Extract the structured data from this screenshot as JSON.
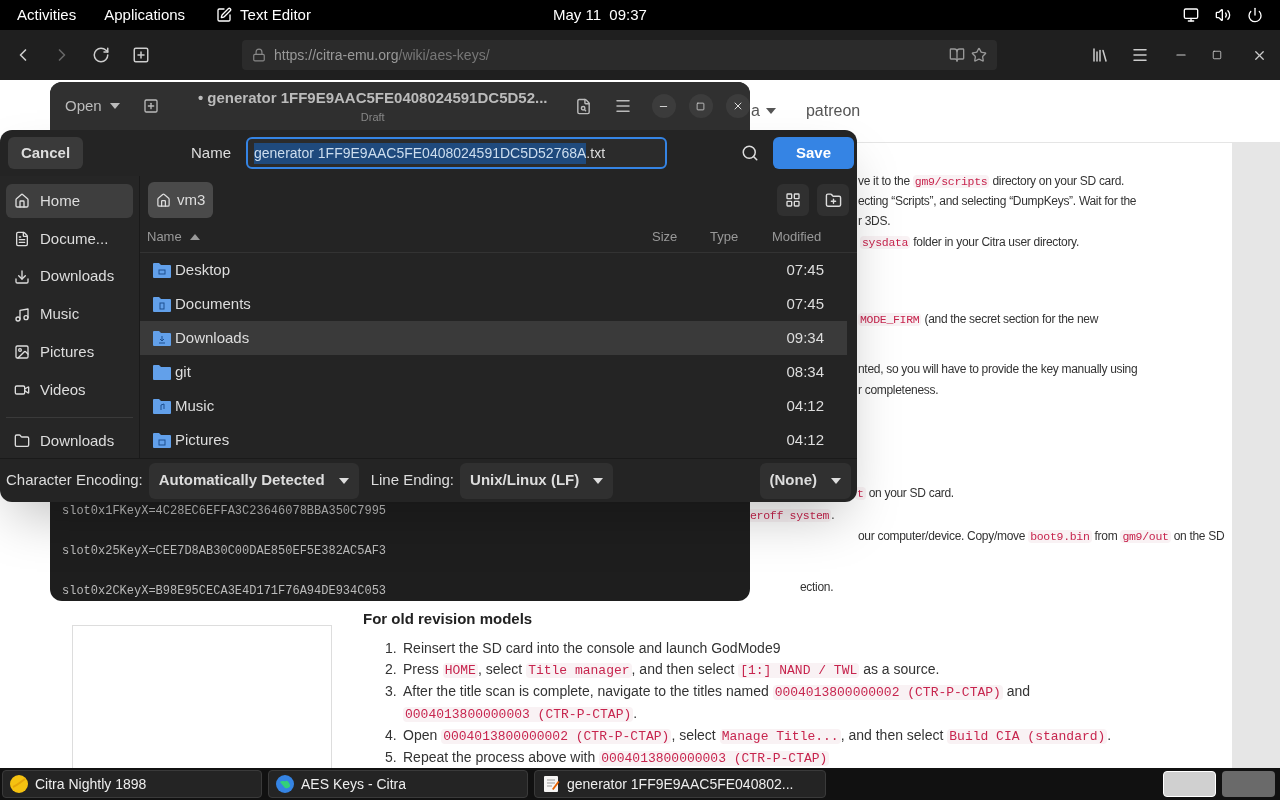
{
  "top_bar": {
    "activities": "Activities",
    "applications": "Applications",
    "app_name": "Text Editor",
    "clock": "May 11  09:37"
  },
  "browser": {
    "url_host": "https://citra-emu.org",
    "url_path": "/wiki/aes-keys/"
  },
  "page": {
    "nav": [
      {
        "label": "a",
        "dropdown": true
      },
      {
        "label": "patreon",
        "dropdown": false
      }
    ],
    "fragments": [
      [
        {
          "t": "ve it to the "
        },
        {
          "t": "gm9/scripts",
          "code": true
        },
        {
          "t": " directory on your SD card."
        }
      ],
      [
        {
          "t": "ecting “Scripts”, and selecting “DumpKeys”. Wait for the"
        }
      ],
      [
        {
          "t": "r 3DS."
        }
      ],
      [
        {
          "t": "sysdata",
          "code": true
        },
        {
          "t": " folder in your Citra user directory."
        }
      ],
      [
        {
          "t": "MODE_FIRM",
          "code": true
        },
        {
          "t": " (and the secret section for the new"
        }
      ],
      [
        {
          "t": "nted, so you will have to provide the key manually using"
        }
      ],
      [
        {
          "t": "r completeness."
        }
      ],
      [
        {
          "t": "t",
          "code": true
        },
        {
          "t": " on your SD card."
        }
      ],
      [
        {
          "t": "eroff system",
          "code": true
        },
        {
          "t": "."
        }
      ],
      [
        {
          "t": "our computer/device. Copy/move "
        },
        {
          "t": "boot9.bin",
          "code": true
        },
        {
          "t": " from "
        },
        {
          "t": "gm9/out",
          "code": true
        },
        {
          "t": " on the SD"
        }
      ],
      [
        {
          "t": "ection."
        }
      ]
    ],
    "heading": "For old revision models",
    "steps": [
      {
        "number": "1.",
        "parts": [
          {
            "t": "Reinsert the SD card into the console and launch GodMode9"
          }
        ]
      },
      {
        "number": "2.",
        "parts": [
          {
            "t": "Press "
          },
          {
            "t": "HOME",
            "code": true
          },
          {
            "t": ", select "
          },
          {
            "t": "Title manager",
            "code": true
          },
          {
            "t": ", and then select "
          },
          {
            "t": "[1:] NAND / TWL",
            "code": true
          },
          {
            "t": " as a source."
          }
        ]
      },
      {
        "number": "3.",
        "parts": [
          {
            "t": "After the title scan is complete, navigate to the titles named "
          },
          {
            "t": "0004013800000002 (CTR-P-CTAP)",
            "code": true
          },
          {
            "t": " and "
          },
          {
            "t": "0004013800000003 (CTR-P-CTAP)",
            "code": true
          },
          {
            "t": "."
          }
        ]
      },
      {
        "number": "4.",
        "parts": [
          {
            "t": "Open "
          },
          {
            "t": "0004013800000002 (CTR-P-CTAP)",
            "code": true
          },
          {
            "t": ", select "
          },
          {
            "t": "Manage Title...",
            "code": true
          },
          {
            "t": ", and then select "
          },
          {
            "t": "Build CIA (standard)",
            "code": true
          },
          {
            "t": "."
          }
        ]
      },
      {
        "number": "5.",
        "parts": [
          {
            "t": "Repeat the process above with "
          },
          {
            "t": "0004013800000003 (CTR-P-CTAP)",
            "code": true
          }
        ]
      }
    ]
  },
  "editor": {
    "open_label": "Open",
    "title": "• generator 1FF9E9AAC5FE0408024591DC5D52...",
    "subtitle": "Draft",
    "lines": [
      "slot0x1FKeyX=4C28EC6EFFA3C23646078BBA350C7995",
      "slot0x25KeyX=CEE7D8AB30C00DAE850EF5E382AC5AF3",
      "slot0x2CKeyX=B98E95CECA3E4D171F76A94DE934C053"
    ]
  },
  "dialog": {
    "cancel": "Cancel",
    "name_label": "Name",
    "name_selected": "generator 1FF9E9AAC5FE0408024591DC5D52768A",
    "name_rest": ".txt",
    "save": "Save",
    "places": [
      {
        "label": "Home",
        "kind": "home",
        "selected": true
      },
      {
        "label": "Docume...",
        "kind": "document",
        "selected": false
      },
      {
        "label": "Downloads",
        "kind": "download",
        "selected": false
      },
      {
        "label": "Music",
        "kind": "music",
        "selected": false
      },
      {
        "label": "Pictures",
        "kind": "pictures",
        "selected": false
      },
      {
        "label": "Videos",
        "kind": "video",
        "selected": false
      }
    ],
    "bookmarks": [
      {
        "label": "Downloads",
        "kind": "folder",
        "selected": false
      }
    ],
    "path": [
      {
        "label": "vm3",
        "selected": true
      }
    ],
    "columns": [
      {
        "label": "Name",
        "sorted": true
      },
      {
        "label": "Size",
        "sorted": false
      },
      {
        "label": "Type",
        "sorted": false
      },
      {
        "label": "Modified",
        "sorted": false
      }
    ],
    "rows": [
      {
        "name": "Desktop",
        "kind": "desktop",
        "modified": "07:45",
        "hovered": false
      },
      {
        "name": "Documents",
        "kind": "documents",
        "modified": "07:45",
        "hovered": false
      },
      {
        "name": "Downloads",
        "kind": "download",
        "modified": "09:34",
        "hovered": true
      },
      {
        "name": "git",
        "kind": "plain",
        "modified": "08:34",
        "hovered": false
      },
      {
        "name": "Music",
        "kind": "music",
        "modified": "04:12",
        "hovered": false
      },
      {
        "name": "Pictures",
        "kind": "pictures",
        "modified": "04:12",
        "hovered": false
      }
    ],
    "encoding_label": "Character Encoding:",
    "encoding": "Automatically Detected",
    "line_ending_label": "Line Ending:",
    "line_ending": "Unix/Linux (LF)",
    "highlight": "(None)"
  },
  "taskbar": [
    {
      "label": "Citra Nightly 1898",
      "kind": "citra",
      "selected": false
    },
    {
      "label": "AES Keys - Citra",
      "kind": "globe",
      "selected": false
    },
    {
      "label": "generator 1FF9E9AAC5FE040802...",
      "kind": "editor",
      "selected": false
    }
  ],
  "workspaces": [
    {
      "selected": true
    },
    {
      "selected": false
    }
  ]
}
